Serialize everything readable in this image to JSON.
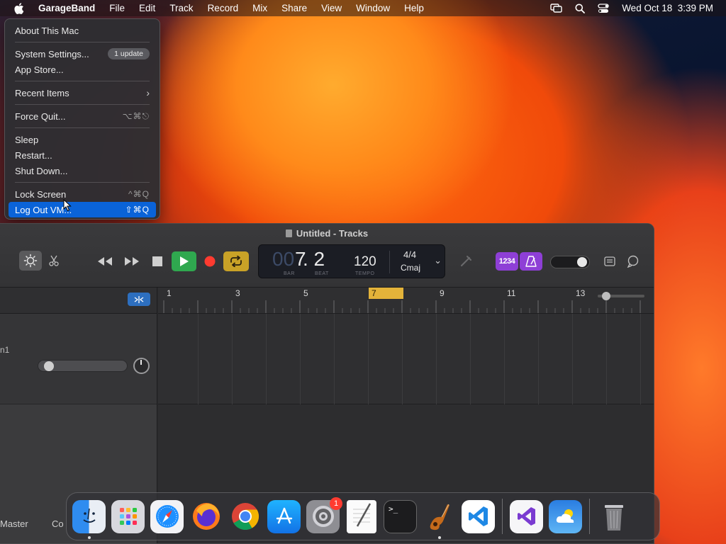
{
  "menubar": {
    "app_name": "GarageBand",
    "items": [
      "File",
      "Edit",
      "Track",
      "Record",
      "Mix",
      "Share",
      "View",
      "Window",
      "Help"
    ],
    "datetime": "Wed Oct 18  3:39 PM"
  },
  "apple_menu": {
    "about": "About This Mac",
    "system_settings": "System Settings...",
    "update_badge": "1 update",
    "app_store": "App Store...",
    "recent_items": "Recent Items",
    "force_quit": "Force Quit...",
    "force_quit_shortcut": "⌥⌘⎋",
    "sleep": "Sleep",
    "restart": "Restart...",
    "shut_down": "Shut Down...",
    "lock_screen": "Lock Screen",
    "lock_screen_shortcut": "^⌘Q",
    "log_out": "Log Out VM...",
    "log_out_shortcut": "⇧⌘Q"
  },
  "garageband": {
    "window_title": "Untitled - Tracks",
    "lcd": {
      "bar_dim": "00",
      "bar": "7",
      "beat": ". 2",
      "bar_label": "BAR",
      "beat_label": "BEAT",
      "tempo": "120",
      "tempo_label": "TEMPO",
      "time_signature": "4/4",
      "key": "Cmaj"
    },
    "count_in": "1234",
    "ruler_marks": [
      "1",
      "3",
      "5",
      "7",
      "9",
      "11",
      "13"
    ],
    "track_name_partial": "n1",
    "bottom_tabs": [
      "Master",
      "Co"
    ]
  },
  "dock": {
    "apps": [
      "Finder",
      "Launchpad",
      "Safari",
      "Firefox",
      "Chrome",
      "App Store",
      "System Settings",
      "TextEdit",
      "Terminal",
      "GarageBand",
      "Visual Studio Code",
      "Visual Studio",
      "Weather",
      "Trash"
    ],
    "settings_badge": "1"
  },
  "colors": {
    "accent_blue": "#0a63d8",
    "play_green": "#2fa84f",
    "record_red": "#ff3b30",
    "cycle_yellow": "#c9a227",
    "smart_purple": "#8e3fd6",
    "playhead_bar": "#e3b33a"
  }
}
